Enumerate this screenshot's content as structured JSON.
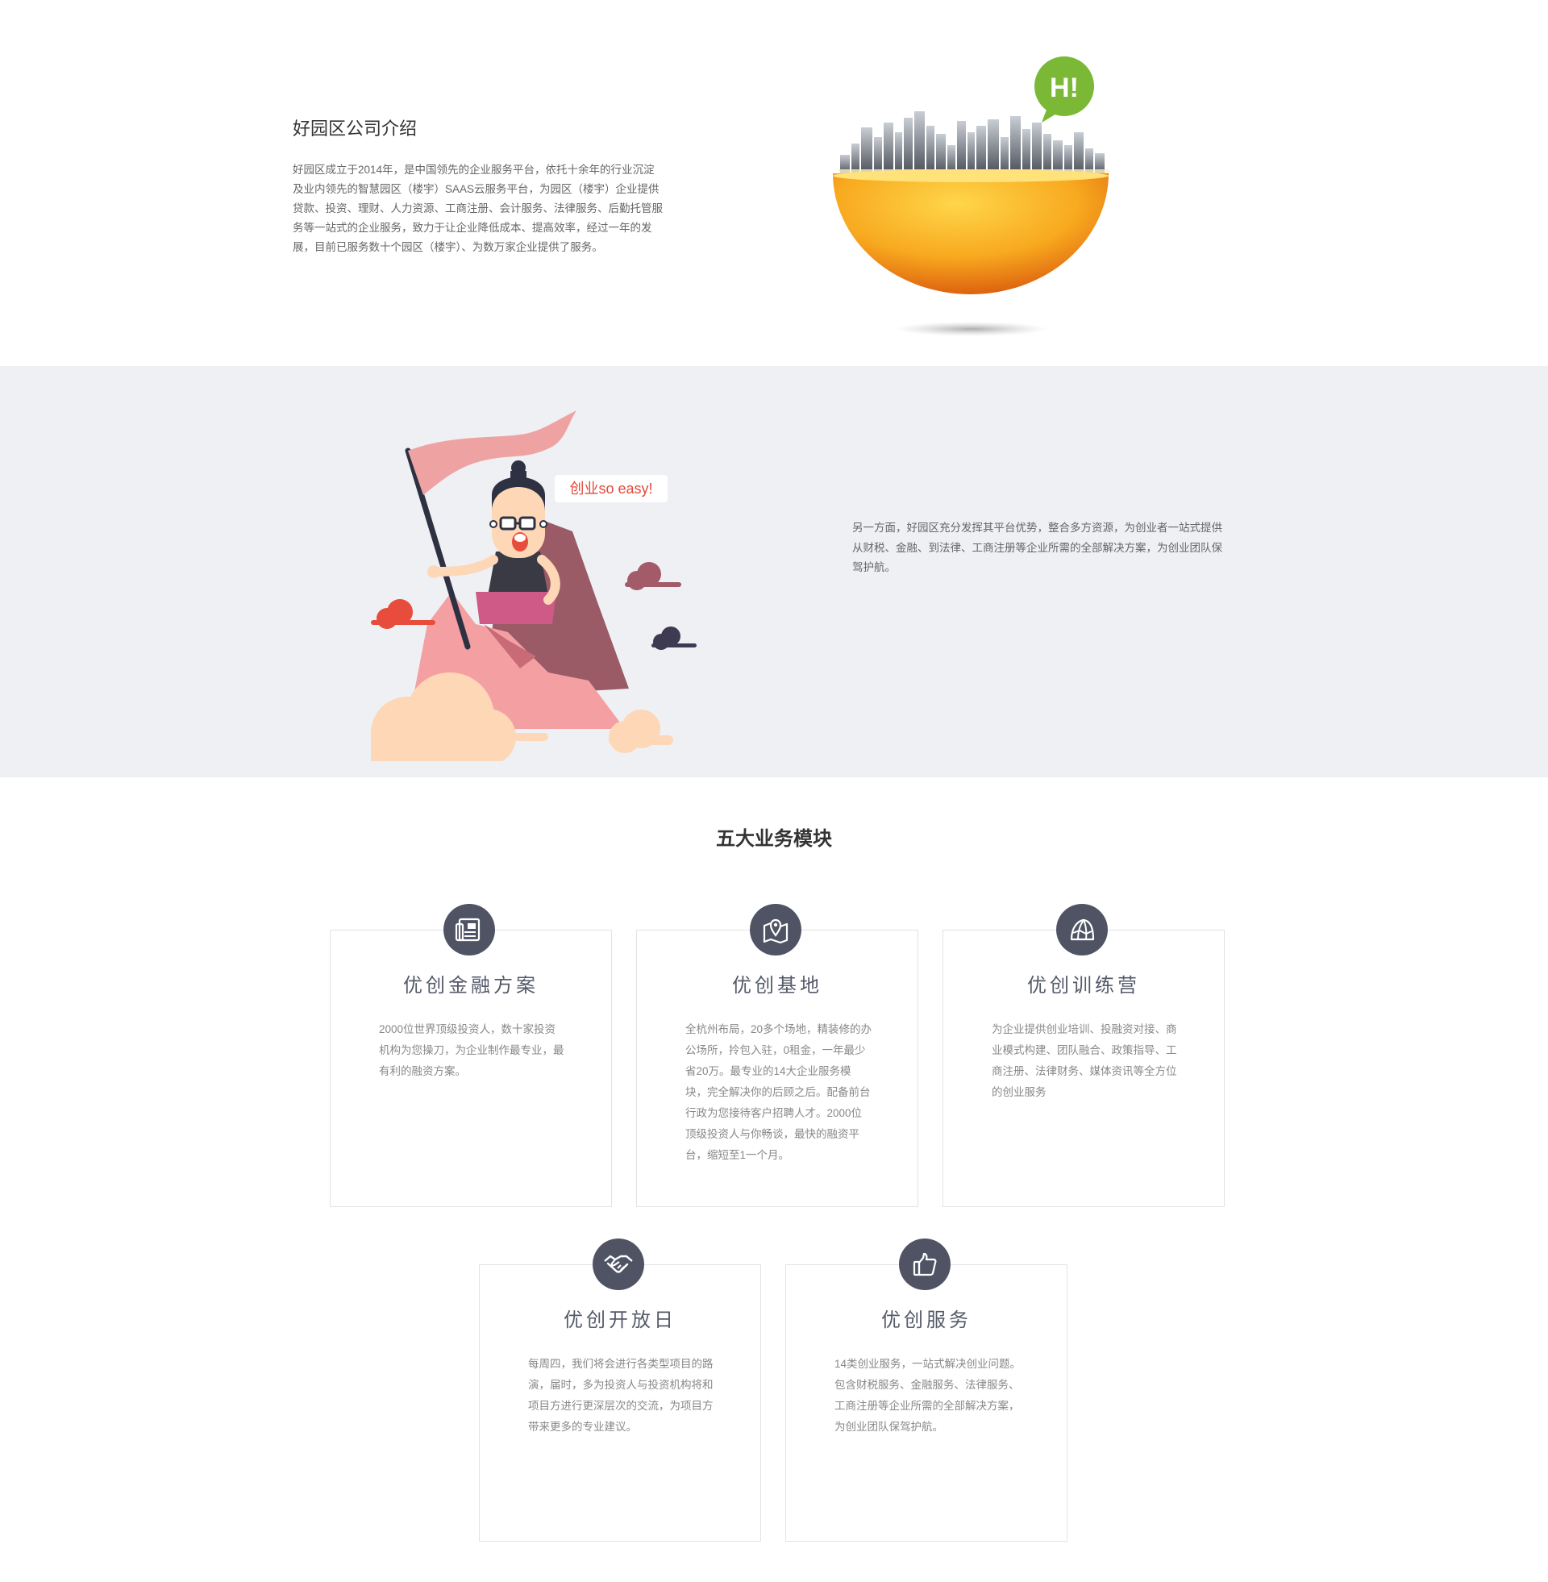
{
  "intro": {
    "title": "好园区公司介绍",
    "text": "好园区成立于2014年，是中国领先的企业服务平台，依托十余年的行业沉淀及业内领先的智慧园区（楼宇）SAAS云服务平台，为园区（楼宇）企业提供贷款、投资、理财、人力资源、工商注册、会计服务、法律服务、后勤托管服务等一站式的企业服务，致力于让企业降低成本、提高效率，经过一年的发展，目前已服务数十个园区（楼宇）、为数万家企业提供了服务。",
    "bubble": "H!"
  },
  "mascot": {
    "speech": "创业so easy!",
    "text": "另一方面，好园区充分发挥其平台优势，整合多方资源，为创业者一站式提供从财税、金融、到法律、工商注册等企业所需的全部解决方案，为创业团队保驾护航。"
  },
  "modules": {
    "title": "五大业务模块",
    "cards": [
      {
        "icon": "finance-document-icon",
        "title": "优创金融方案",
        "text": "2000位世界顶级投资人，数十家投资机构为您操刀，为企业制作最专业，最有利的融资方案。"
      },
      {
        "icon": "map-pin-icon",
        "title": "优创基地",
        "text": "全杭州布局，20多个场地，精装修的办公场所，拎包入驻，0租金，一年最少省20万。最专业的14大企业服务模块，完全解决你的后顾之后。配备前台行政为您接待客户招聘人才。2000位顶级投资人与你畅谈，最快的融资平台，缩短至1一个月。"
      },
      {
        "icon": "tent-icon",
        "title": "优创训练营",
        "text": "为企业提供创业培训、投融资对接、商业模式构建、团队融合、政策指导、工商注册、法律财务、媒体资讯等全方位的创业服务"
      },
      {
        "icon": "handshake-icon",
        "title": "优创开放日",
        "text": "每周四，我们将会进行各类型项目的路演，届时，多为投资人与投资机构将和项目方进行更深层次的交流，为项目方带来更多的专业建议。"
      },
      {
        "icon": "thumbs-up-icon",
        "title": "优创服务",
        "text": "14类创业服务，一站式解决创业问题。包含财税服务、金融服务、法律服务、工商注册等企业所需的全部解决方案，为创业团队保驾护航。"
      }
    ]
  },
  "colors": {
    "band_bg": "#eff0f4",
    "icon_bg": "#4f5364",
    "accent_red": "#e2493b",
    "bubble_green": "#7ab836",
    "orange": "#f7a21b"
  }
}
